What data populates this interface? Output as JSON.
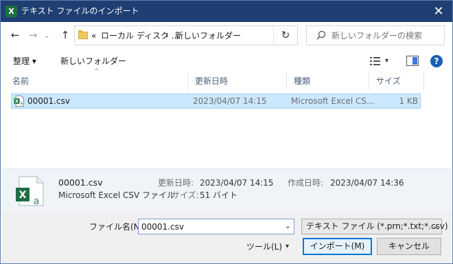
{
  "window": {
    "title": "テキスト ファイルのインポート",
    "app_icon": "X",
    "close_label": "✕"
  },
  "nav": {
    "back_icon": "←",
    "forward_icon": "→",
    "recent_icon": "⌄",
    "up_icon": "↑"
  },
  "address": {
    "overflow": "«",
    "crumb1": "ローカル ディスク ...",
    "separator": "›",
    "crumb2": "新しいフォルダー",
    "refresh_icon": "↻"
  },
  "search": {
    "placeholder": "新しいフォルダーの検索"
  },
  "commands": {
    "organize": "整理 ▾",
    "new_folder": "新しいフォルダー",
    "view_arrow": "▾",
    "help": "?"
  },
  "list": {
    "sort_caret": "^",
    "columns": [
      "名前",
      "更新日時",
      "種類",
      "サイズ"
    ],
    "rows": [
      {
        "name": "00001.csv",
        "modified": "2023/04/07 14:15",
        "type": "Microsoft Excel CS...",
        "size": "1 KB"
      }
    ]
  },
  "details": {
    "name": "00001.csv",
    "type": "Microsoft Excel CSV ファイル",
    "modified_label": "更新日時:",
    "modified_value": "2023/04/07 14:15",
    "size_label": "サイズ:",
    "size_value": "51 バイト",
    "created_label": "作成日時:",
    "created_value": "2023/04/07 14:36"
  },
  "footer": {
    "filename_label": "ファイル名(N):",
    "filename_value": "00001.csv",
    "combo_arrow": "⌄",
    "filetype": "テキスト ファイル (*.prn;*.txt;*.csv)",
    "type_arrow": "⌄",
    "tools_label": "ツール(L)",
    "tools_arrow": "▾",
    "import_label": "インポート(M)",
    "cancel_label": "キャンセル"
  },
  "colors": {
    "titlebar": "#1f3f73",
    "selection": "#cce8ff",
    "excel_green": "#1d6f42",
    "accent": "#0078d7"
  }
}
